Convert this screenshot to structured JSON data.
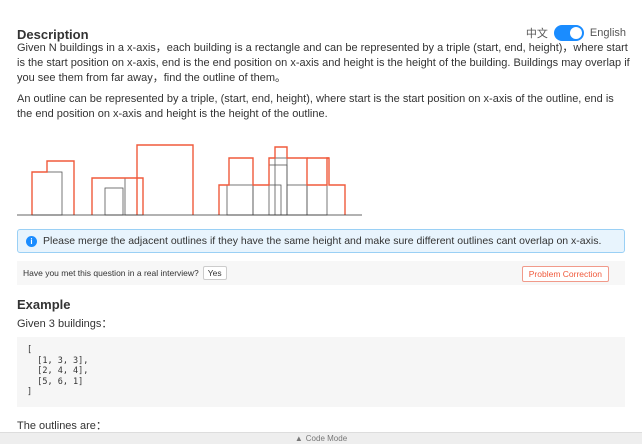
{
  "description": {
    "title": "Description",
    "lang_zh": "中文",
    "lang_en": "English",
    "para1": "Given N buildings in a x-axis，each building is a rectangle and can be represented by a triple (start, end, height)，where start is the start position on x-axis, end is the end position on x-axis and height is the height of the building. Buildings may overlap if you see them from far away，find the outline of them。",
    "para2": "An outline can be represented by a triple, (start, end, height), where start is the start position on x-axis of the outline, end is the end position on x-axis and height is the height of the outline."
  },
  "note": {
    "text": "Please merge the adjacent outlines if they have the same height and make sure different outlines cant overlap on x-axis."
  },
  "interview": {
    "question": "Have you met this question in a real interview?",
    "yes_label": "Yes",
    "correction_label": "Problem Correction"
  },
  "example": {
    "title": "Example",
    "desc": "Given 3 buildings：",
    "code": "[\n  [1, 3, 3],\n  [2, 4, 4],\n  [5, 6, 1]\n]",
    "outlines_label": "The outlines are："
  },
  "footer": {
    "label": "Code Mode"
  },
  "colors": {
    "accent": "#1a8cff",
    "outline": "#f05a3c"
  }
}
